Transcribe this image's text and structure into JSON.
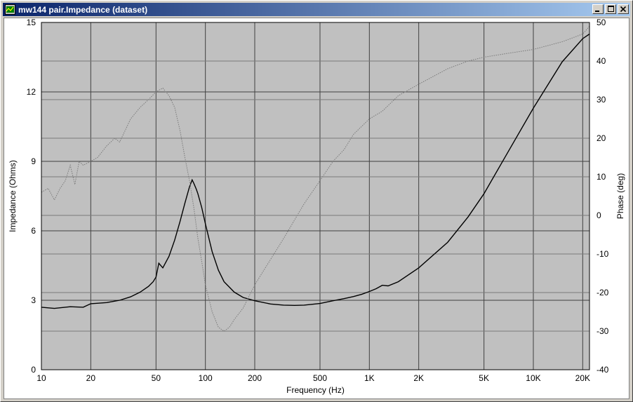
{
  "window": {
    "title": "mw144 pair.Impedance (dataset)",
    "icons": [
      "app-icon",
      "minimize-icon",
      "maximize-icon",
      "close-icon"
    ]
  },
  "chart_data": {
    "type": "line",
    "xlabel": "Frequency (Hz)",
    "ylabel": "Impedance (Ohms)",
    "y2label": "Phase (deg)",
    "xscale": "log",
    "xlim": [
      10,
      22000
    ],
    "ylim": [
      0,
      15
    ],
    "y2lim": [
      -40,
      50
    ],
    "grid": true,
    "x_ticks": [
      {
        "v": 10,
        "label": "10"
      },
      {
        "v": 20,
        "label": "20"
      },
      {
        "v": 50,
        "label": "50"
      },
      {
        "v": 100,
        "label": "100"
      },
      {
        "v": 200,
        "label": "200"
      },
      {
        "v": 500,
        "label": "500"
      },
      {
        "v": 1000,
        "label": "1K"
      },
      {
        "v": 2000,
        "label": "2K"
      },
      {
        "v": 5000,
        "label": "5K"
      },
      {
        "v": 10000,
        "label": "10K"
      },
      {
        "v": 20000,
        "label": "20K"
      }
    ],
    "y_ticks": [
      {
        "v": 0,
        "label": "0"
      },
      {
        "v": 3,
        "label": "3"
      },
      {
        "v": 6,
        "label": "6"
      },
      {
        "v": 9,
        "label": "9"
      },
      {
        "v": 12,
        "label": "12"
      },
      {
        "v": 15,
        "label": "15"
      }
    ],
    "y2_ticks": [
      {
        "v": -40,
        "label": "-40"
      },
      {
        "v": -30,
        "label": "-30"
      },
      {
        "v": -20,
        "label": "-20"
      },
      {
        "v": -10,
        "label": "-10"
      },
      {
        "v": 0,
        "label": "0"
      },
      {
        "v": 10,
        "label": "10"
      },
      {
        "v": 20,
        "label": "20"
      },
      {
        "v": 30,
        "label": "30"
      },
      {
        "v": 40,
        "label": "40"
      },
      {
        "v": 50,
        "label": "50"
      }
    ],
    "series": [
      {
        "style": "solid",
        "color": "#000000",
        "axis": "left",
        "x": [
          10,
          12,
          15,
          18,
          20,
          25,
          30,
          35,
          40,
          45,
          48,
          50,
          52,
          55,
          60,
          65,
          70,
          75,
          80,
          83,
          85,
          88,
          90,
          95,
          100,
          110,
          120,
          130,
          150,
          170,
          200,
          250,
          300,
          350,
          400,
          500,
          600,
          700,
          800,
          900,
          1000,
          1100,
          1200,
          1300,
          1500,
          2000,
          3000,
          4000,
          5000,
          7000,
          10000,
          15000,
          20000,
          22000
        ],
        "y": [
          2.7,
          2.65,
          2.72,
          2.7,
          2.85,
          2.9,
          3.0,
          3.15,
          3.35,
          3.6,
          3.8,
          4.0,
          4.6,
          4.4,
          4.9,
          5.6,
          6.4,
          7.2,
          7.9,
          8.2,
          8.05,
          7.8,
          7.6,
          7.0,
          6.3,
          5.1,
          4.3,
          3.8,
          3.35,
          3.12,
          2.98,
          2.84,
          2.79,
          2.78,
          2.79,
          2.86,
          2.98,
          3.07,
          3.16,
          3.26,
          3.38,
          3.5,
          3.65,
          3.62,
          3.8,
          4.4,
          5.5,
          6.6,
          7.6,
          9.4,
          11.3,
          13.3,
          14.3,
          14.5
        ]
      },
      {
        "style": "dotted",
        "color": "#7a7a7a",
        "axis": "right",
        "x": [
          10,
          11,
          12,
          13,
          14,
          15,
          16,
          17,
          18,
          20,
          22,
          25,
          28,
          30,
          35,
          40,
          45,
          50,
          55,
          60,
          65,
          70,
          75,
          80,
          85,
          90,
          95,
          100,
          110,
          120,
          130,
          140,
          150,
          170,
          200,
          300,
          400,
          500,
          600,
          700,
          800,
          1000,
          1200,
          1500,
          2000,
          3000,
          4000,
          5000,
          7000,
          10000,
          15000,
          20000,
          22000
        ],
        "y": [
          6,
          7,
          4,
          7,
          9,
          13,
          8,
          14,
          13,
          14,
          15,
          18,
          20,
          19,
          25,
          28,
          30,
          32,
          33,
          31,
          28,
          22,
          15,
          9,
          2,
          -6,
          -12,
          -18,
          -25,
          -29,
          -30,
          -29,
          -27,
          -24,
          -18,
          -6,
          3,
          9,
          14,
          17,
          21,
          25,
          27,
          31,
          34,
          38,
          40,
          41,
          42,
          43,
          45,
          47,
          49
        ]
      }
    ]
  }
}
